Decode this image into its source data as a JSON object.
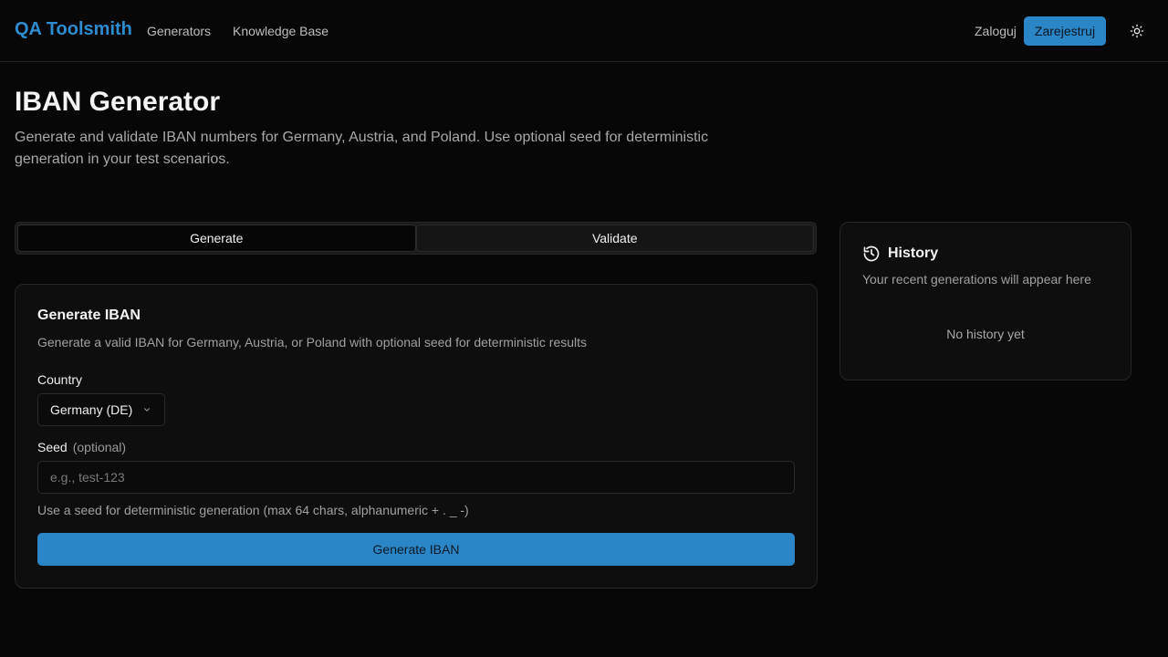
{
  "header": {
    "brand": "QA Toolsmith",
    "nav": [
      {
        "label": "Generators"
      },
      {
        "label": "Knowledge Base"
      }
    ],
    "login_label": "Zaloguj",
    "register_label": "Zarejestruj",
    "theme_icon": "sun-icon"
  },
  "page": {
    "title": "IBAN Generator",
    "description": "Generate and validate IBAN numbers for Germany, Austria, and Poland. Use optional seed for deterministic generation in your test scenarios."
  },
  "tabs": [
    {
      "label": "Generate",
      "active": true
    },
    {
      "label": "Validate",
      "active": false
    }
  ],
  "generate_card": {
    "title": "Generate IBAN",
    "description": "Generate a valid IBAN for Germany, Austria, or Poland with optional seed for deterministic results",
    "country_label": "Country",
    "country_value": "Germany (DE)",
    "seed_label": "Seed",
    "seed_optional": "(optional)",
    "seed_placeholder": "e.g., test-123",
    "seed_value": "",
    "seed_hint": "Use a seed for deterministic generation (max 64 chars, alphanumeric + . _ -)",
    "button_label": "Generate IBAN"
  },
  "history": {
    "icon": "history-icon",
    "title": "History",
    "description": "Your recent generations will appear here",
    "empty_text": "No history yet"
  },
  "colors": {
    "accent": "#2a86c6",
    "brand": "#2d8ccf",
    "background": "#070707",
    "card": "#0e0e0e"
  }
}
